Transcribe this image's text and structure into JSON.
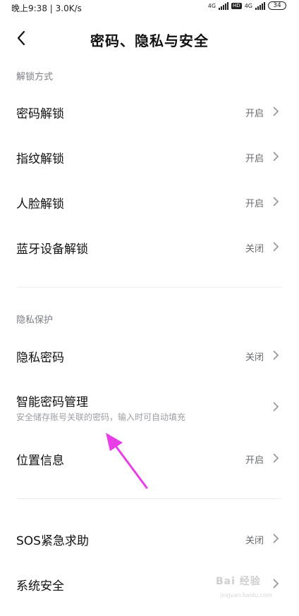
{
  "status_bar": {
    "time_speed": "晚上9:38 | 3.0K/s",
    "network_1": "4G",
    "hd": "HD",
    "network_2": "4G",
    "battery": "34"
  },
  "header": {
    "title": "密码、隐私与安全"
  },
  "sections": {
    "unlock": {
      "title": "解锁方式",
      "items": [
        {
          "label": "密码解锁",
          "value": "开启"
        },
        {
          "label": "指纹解锁",
          "value": "开启"
        },
        {
          "label": "人脸解锁",
          "value": "开启"
        },
        {
          "label": "蓝牙设备解锁",
          "value": "关闭"
        }
      ]
    },
    "privacy": {
      "title": "隐私保护",
      "items": [
        {
          "label": "隐私密码",
          "value": "关闭"
        },
        {
          "label": "智能密码管理",
          "subtitle": "安全储存账号关联的密码，输入时可自动填充"
        },
        {
          "label": "位置信息",
          "value": "开启"
        }
      ]
    },
    "other": {
      "items": [
        {
          "label": "SOS紧急求助",
          "value": "关闭"
        },
        {
          "label": "系统安全"
        }
      ]
    }
  },
  "annotation": {
    "arrow_color": "#e83ee8"
  },
  "watermark": {
    "logo": "Bai 经验",
    "url": "jingyan.baidu.com"
  },
  "colors": {
    "background": "#ffffff",
    "text": "#111111",
    "section_header": "#7a7e86",
    "value": "#666a70",
    "chevron": "#9a9a9a"
  }
}
